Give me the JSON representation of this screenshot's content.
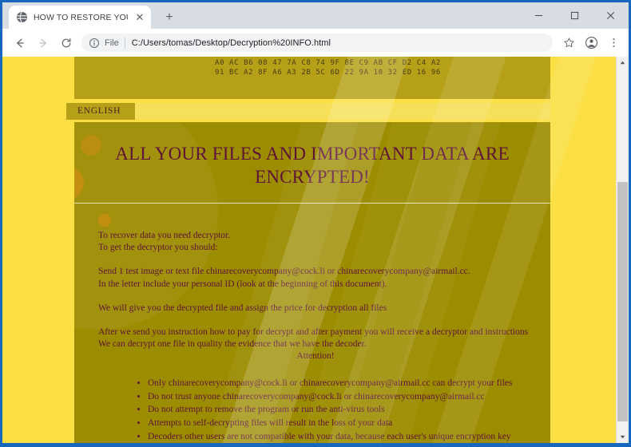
{
  "browser": {
    "tab": {
      "title": "HOW TO RESTORE YOUR FILES",
      "favicon": "globe-icon",
      "close_label": "✕"
    },
    "new_tab_label": "+",
    "window_controls": {
      "minimize": "–",
      "maximize": "□",
      "close": "✕"
    },
    "toolbar": {
      "back": "←",
      "forward": "→",
      "reload": "⟳",
      "bookmark": "☆",
      "profile": "profile-icon",
      "menu": "⋮"
    },
    "omnibox": {
      "info_icon": "info-circle-icon",
      "scheme_label": "File",
      "url": "C:/Users/tomas/Desktop/Decryption%20INFO.html"
    }
  },
  "page": {
    "hex_dump": "A0 AC B6 08 47 7A C8 74 9F 8E C9 AB CF D2 C4 A2\n91 BC A2 8F A6 A3 2B 5C 6D 22 9A 10 32 ED 16 96",
    "language_tab": "ENGLISH",
    "title": "ALL YOUR FILES AND IMPORTANT DATA ARE ENCRYPTED!",
    "paragraphs": [
      "To recover data you need decryptor.",
      "To get the decryptor you should:",
      "Send 1 test image or text file chinarecoverycompany@cock.li or chinarecoverycompany@airmail.cc.",
      "In the letter include your personal ID (look at the beginning of this document).",
      "We will give you the decrypted file and assign the price for decryption all files",
      "After we send you instruction how to pay for decrypt and after payment you will receive a decryptor and instructions We can decrypt one file in quality the evidence that we have the decoder.",
      "Attention!"
    ],
    "bullets": [
      "Only chinarecoverycompany@cock.li or chinarecoverycompany@airmail.cc can decrypt your files",
      "Do not trust anyone chinarecoverycompany@cock.li or chinarecoverycompany@airmail.cc",
      "Do not attempt to remove the program or run the anti-virus tools",
      "Attempts to self-decrypting files will result in the loss of your data",
      "Decoders other users are not compatible with your data, because each user's unique encryption key"
    ],
    "colors": {
      "page_background": "#fbdf44",
      "note_panel": "#9c8c00",
      "hex_panel": "#b5a017",
      "text": "#5e1436",
      "window_frame": "#1667bd"
    }
  },
  "scrollbar": {
    "up_arrow": "▲",
    "down_arrow": "▼"
  }
}
